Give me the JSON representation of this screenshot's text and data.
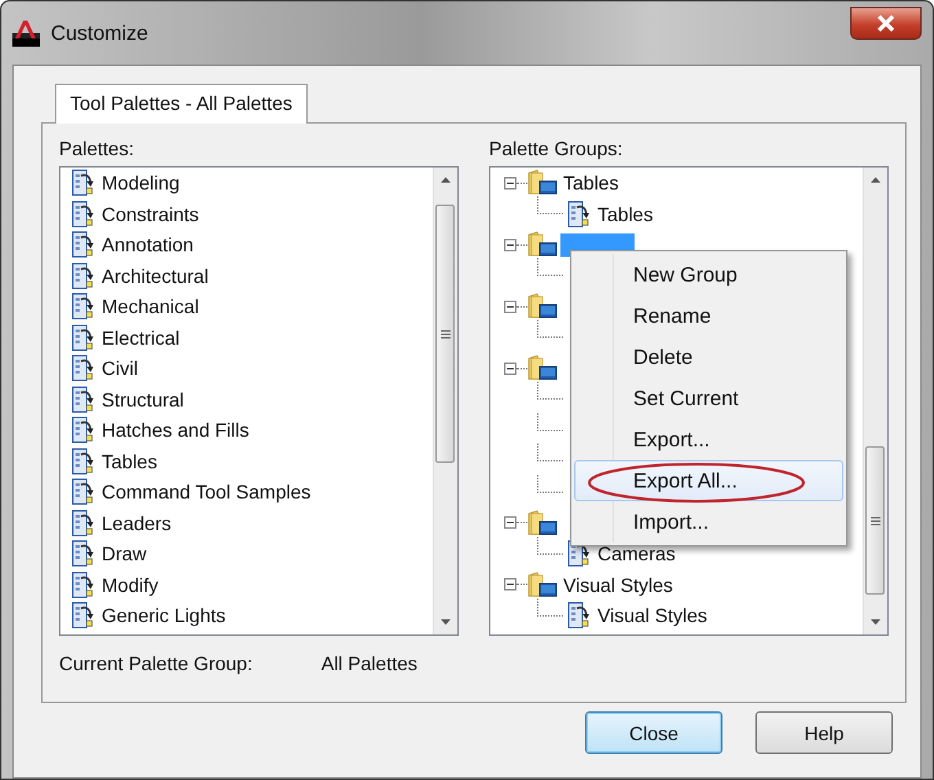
{
  "window": {
    "title": "Customize"
  },
  "tabs": [
    {
      "label": "Tool Palettes - All Palettes",
      "selected": true
    }
  ],
  "palettes": {
    "label": "Palettes:",
    "items": [
      "Modeling",
      "Constraints",
      "Annotation",
      "Architectural",
      "Mechanical",
      "Electrical",
      "Civil",
      "Structural",
      "Hatches and Fills",
      "Tables",
      "Command Tool Samples",
      "Leaders",
      "Draw",
      "Modify",
      "Generic Lights"
    ]
  },
  "palette_groups": {
    "label": "Palette Groups:",
    "groups": [
      {
        "label": "Tables",
        "selected": false,
        "expanded": true,
        "children": [
          {
            "kind": "palette",
            "label": "Tables"
          }
        ]
      },
      {
        "selected": true,
        "expanded": true,
        "children": [
          {
            "kind": "covered"
          }
        ]
      },
      {
        "selected": false,
        "expanded": true,
        "children": [
          {
            "kind": "covered"
          }
        ]
      },
      {
        "selected": false,
        "expanded": true,
        "children": [
          {
            "kind": "covered"
          },
          {
            "kind": "covered"
          },
          {
            "kind": "covered"
          },
          {
            "kind": "covered"
          }
        ]
      },
      {
        "selected": false,
        "expanded": true,
        "children": [
          {
            "kind": "palette",
            "label": "Cameras"
          }
        ]
      },
      {
        "label": "Visual Styles",
        "selected": false,
        "expanded": true,
        "children": [
          {
            "kind": "palette",
            "label": "Visual Styles"
          }
        ]
      }
    ]
  },
  "context_menu": {
    "items": [
      {
        "label": "New Group",
        "selected": false
      },
      {
        "label": "Rename",
        "selected": false
      },
      {
        "label": "Delete",
        "selected": false
      },
      {
        "label": "Set Current",
        "selected": false
      },
      {
        "label": "Export...",
        "selected": false
      },
      {
        "label": "Export All...",
        "selected": true,
        "circled": true
      },
      {
        "label": "Import...",
        "selected": false
      }
    ]
  },
  "current_group": {
    "label": "Current Palette Group:",
    "value": "All Palettes"
  },
  "buttons": [
    {
      "label": "Close",
      "default": true
    },
    {
      "label": "Help",
      "default": false
    }
  ]
}
